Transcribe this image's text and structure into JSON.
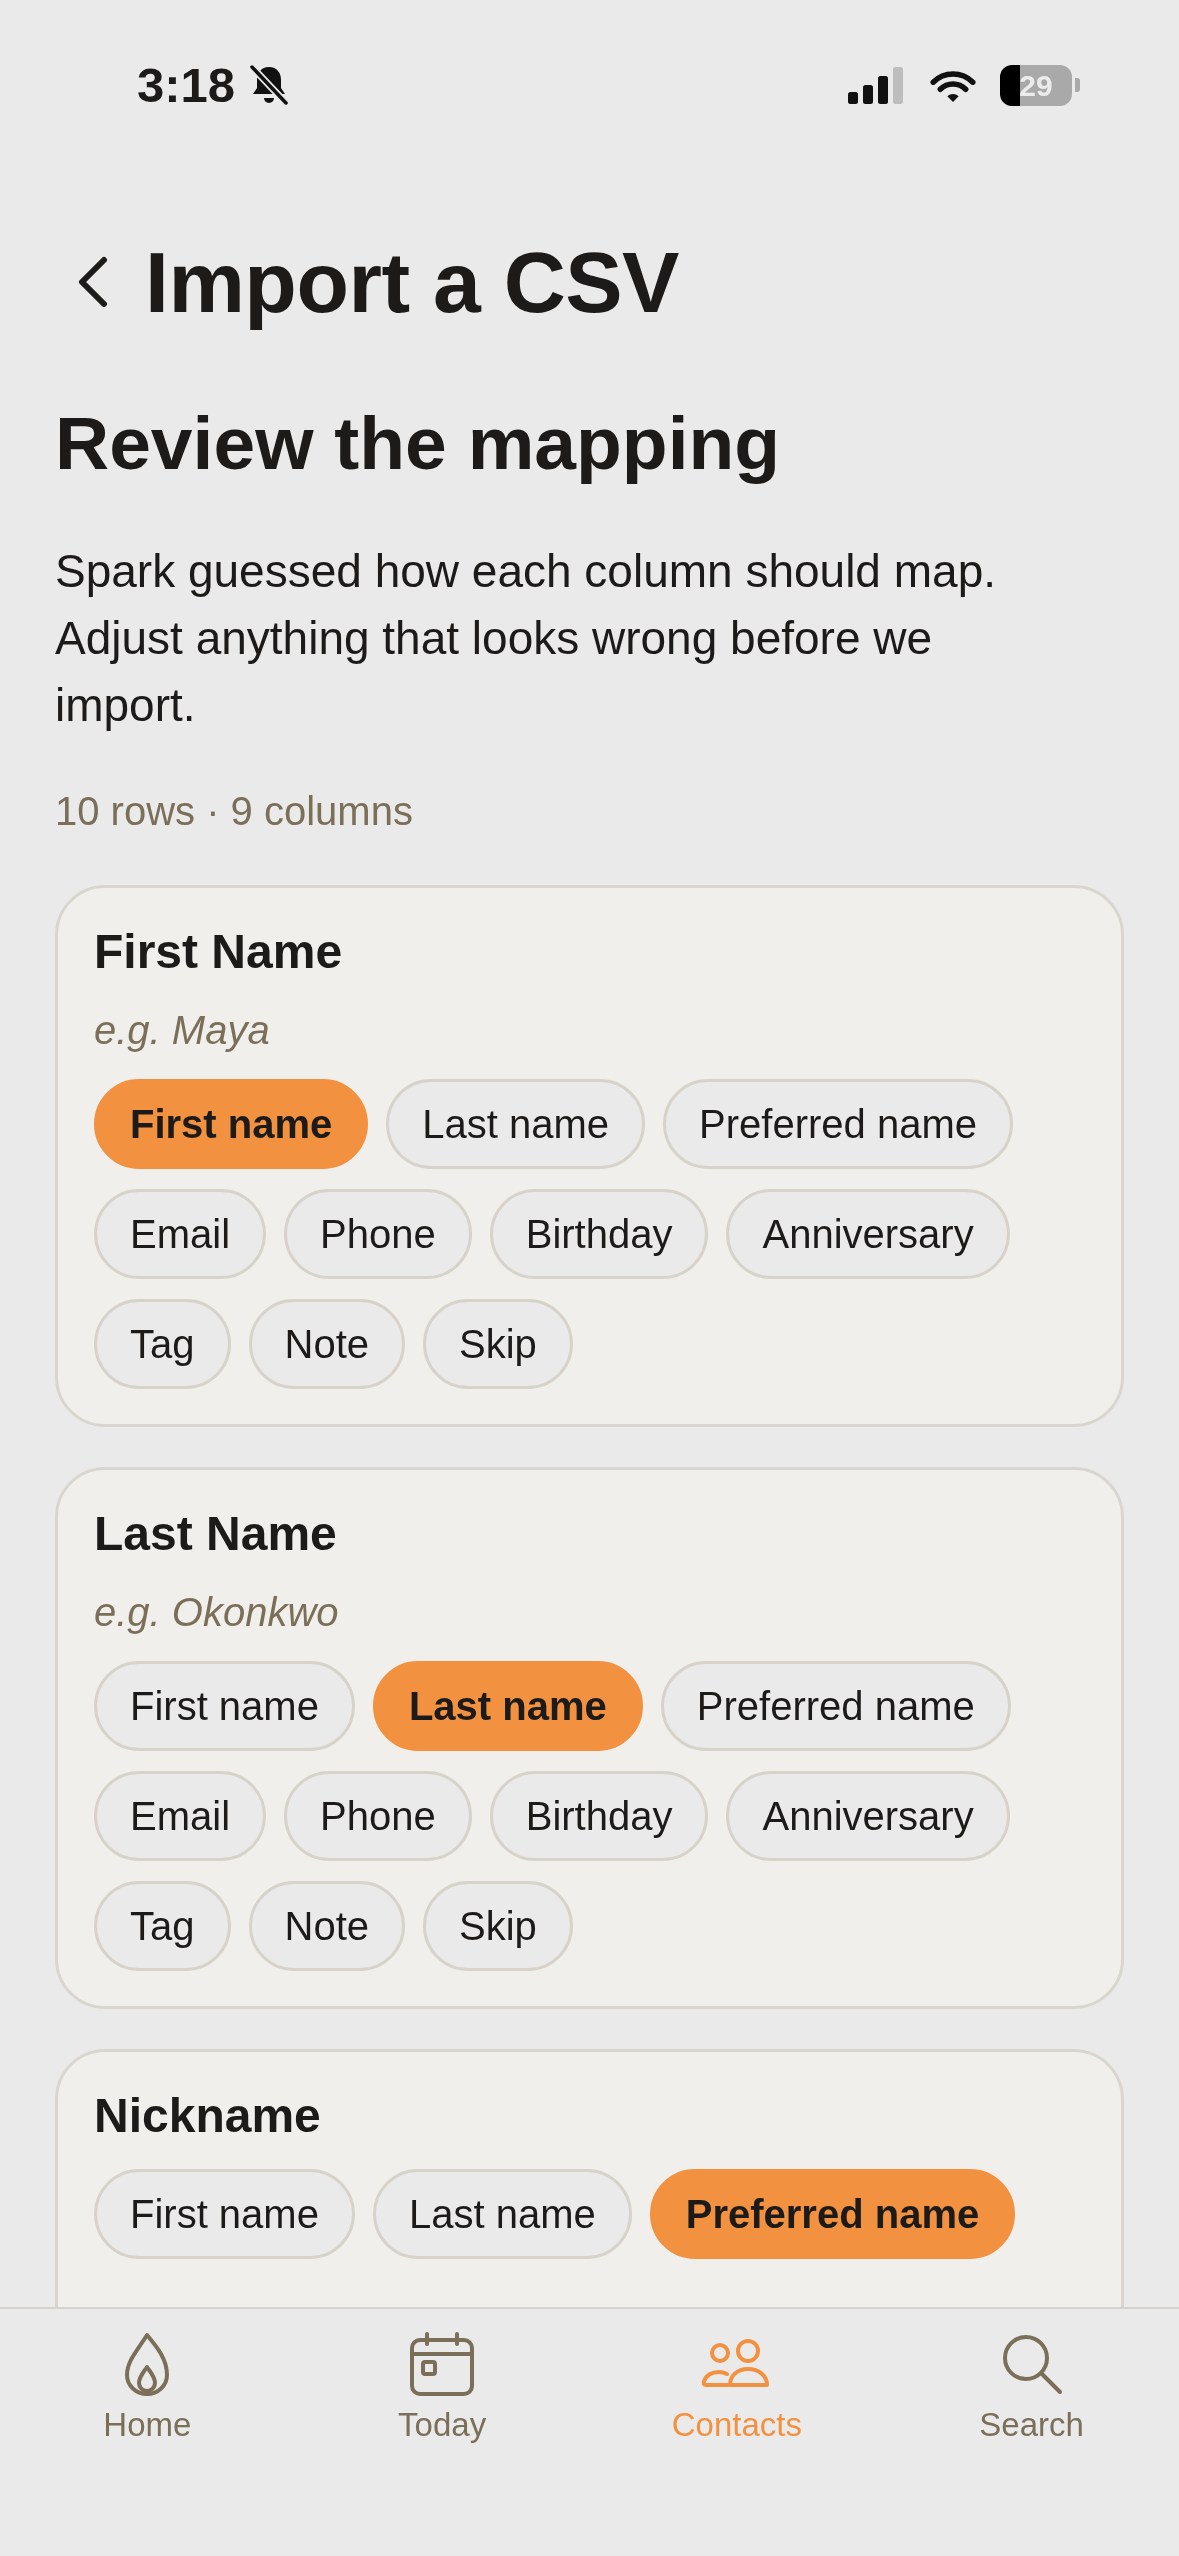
{
  "status_bar": {
    "time": "3:18",
    "battery": "29"
  },
  "header": {
    "title": "Import a CSV"
  },
  "intro": {
    "title": "Review the mapping",
    "description": "Spark guessed how each column should map. Adjust anything that looks wrong before we import.",
    "summary": "10 rows · 9 columns"
  },
  "columns": [
    {
      "name": "First Name",
      "example": "e.g. Maya",
      "options": [
        {
          "label": "First name",
          "selected": true
        },
        {
          "label": "Last name",
          "selected": false
        },
        {
          "label": "Preferred name",
          "selected": false
        },
        {
          "label": "Email",
          "selected": false
        },
        {
          "label": "Phone",
          "selected": false
        },
        {
          "label": "Birthday",
          "selected": false
        },
        {
          "label": "Anniversary",
          "selected": false
        },
        {
          "label": "Tag",
          "selected": false
        },
        {
          "label": "Note",
          "selected": false
        },
        {
          "label": "Skip",
          "selected": false
        }
      ]
    },
    {
      "name": "Last Name",
      "example": "e.g. Okonkwo",
      "options": [
        {
          "label": "First name",
          "selected": false
        },
        {
          "label": "Last name",
          "selected": true
        },
        {
          "label": "Preferred name",
          "selected": false
        },
        {
          "label": "Email",
          "selected": false
        },
        {
          "label": "Phone",
          "selected": false
        },
        {
          "label": "Birthday",
          "selected": false
        },
        {
          "label": "Anniversary",
          "selected": false
        },
        {
          "label": "Tag",
          "selected": false
        },
        {
          "label": "Note",
          "selected": false
        },
        {
          "label": "Skip",
          "selected": false
        }
      ]
    },
    {
      "name": "Nickname",
      "options": [
        {
          "label": "First name",
          "selected": false
        },
        {
          "label": "Last name",
          "selected": false
        },
        {
          "label": "Preferred name",
          "selected": true
        }
      ]
    }
  ],
  "tab_bar": [
    {
      "label": "Home",
      "selected": false
    },
    {
      "label": "Today",
      "selected": false
    },
    {
      "label": "Contacts",
      "selected": true
    },
    {
      "label": "Search",
      "selected": false
    }
  ]
}
